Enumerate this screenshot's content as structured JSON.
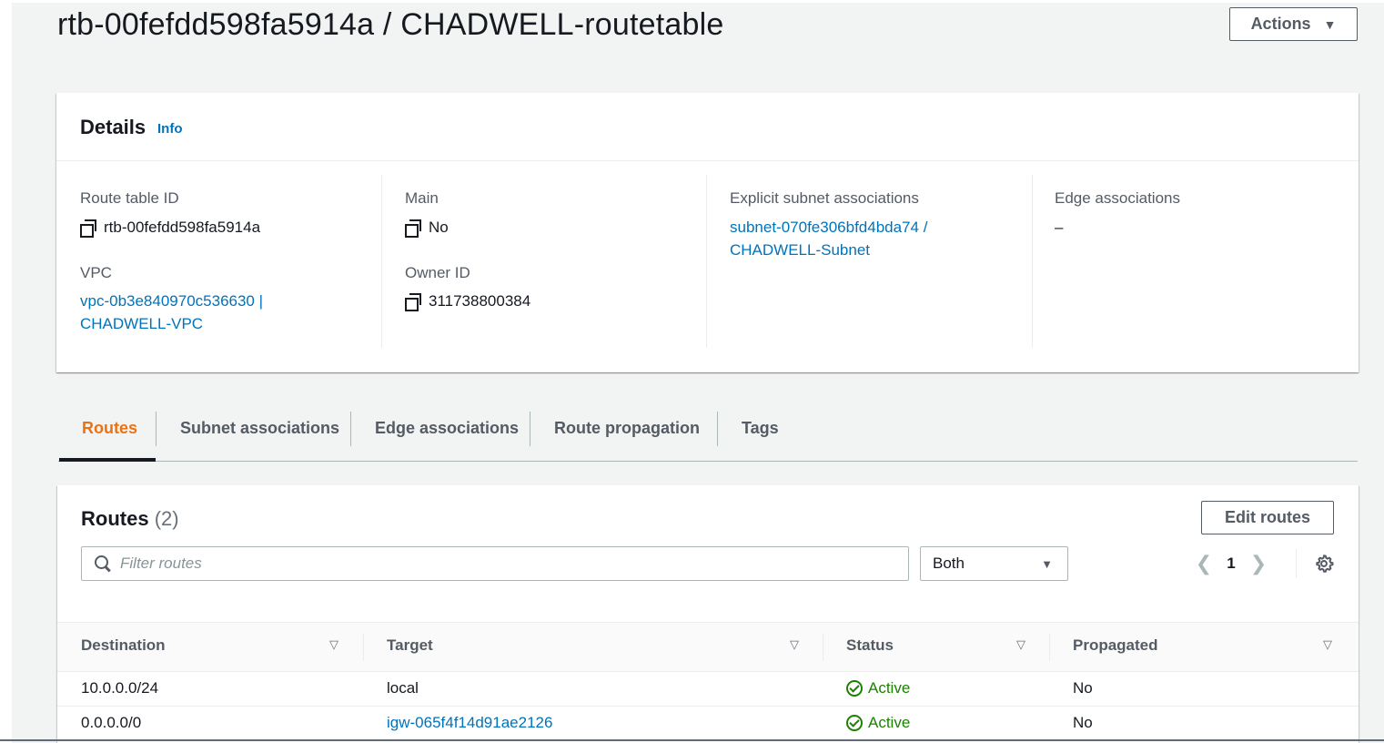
{
  "page": {
    "title": "rtb-00fefdd598fa5914a / CHADWELL-routetable",
    "actions_label": "Actions"
  },
  "details": {
    "title": "Details",
    "info_label": "Info",
    "route_table_id_label": "Route table ID",
    "route_table_id": "rtb-00fefdd598fa5914a",
    "vpc_label": "VPC",
    "vpc_line1": "vpc-0b3e840970c536630 |",
    "vpc_line2": "CHADWELL-VPC",
    "main_label": "Main",
    "main_value": "No",
    "owner_id_label": "Owner ID",
    "owner_id": "311738800384",
    "explicit_subnet_label": "Explicit subnet associations",
    "explicit_subnet_line1": "subnet-070fe306bfd4bda74 /",
    "explicit_subnet_line2": "CHADWELL-Subnet",
    "edge_assoc_label": "Edge associations",
    "edge_assoc_value": "–"
  },
  "tabs": [
    {
      "label": "Routes",
      "active": true
    },
    {
      "label": "Subnet associations",
      "active": false
    },
    {
      "label": "Edge associations",
      "active": false
    },
    {
      "label": "Route propagation",
      "active": false
    },
    {
      "label": "Tags",
      "active": false
    }
  ],
  "routes": {
    "title": "Routes",
    "count": "(2)",
    "edit_label": "Edit routes",
    "filter_placeholder": "Filter routes",
    "filter_value": "",
    "select_value": "Both",
    "page_number": "1",
    "columns": [
      "Destination",
      "Target",
      "Status",
      "Propagated"
    ],
    "rows": [
      {
        "destination": "10.0.0.0/24",
        "target": "local",
        "target_is_link": false,
        "status": "Active",
        "propagated": "No"
      },
      {
        "destination": "0.0.0.0/0",
        "target": "igw-065f4f14d91ae2126",
        "target_is_link": true,
        "status": "Active",
        "propagated": "No"
      }
    ]
  },
  "icons": {
    "copy": "copy-icon",
    "search": "search-icon",
    "settings": "gear-icon",
    "status": "check-circle-icon",
    "sort": "sort-down-icon"
  },
  "colors": {
    "link": "#0073bb",
    "active_tab": "#ec7211",
    "success": "#1d8102",
    "text": "#16191f",
    "muted": "#545b64"
  }
}
